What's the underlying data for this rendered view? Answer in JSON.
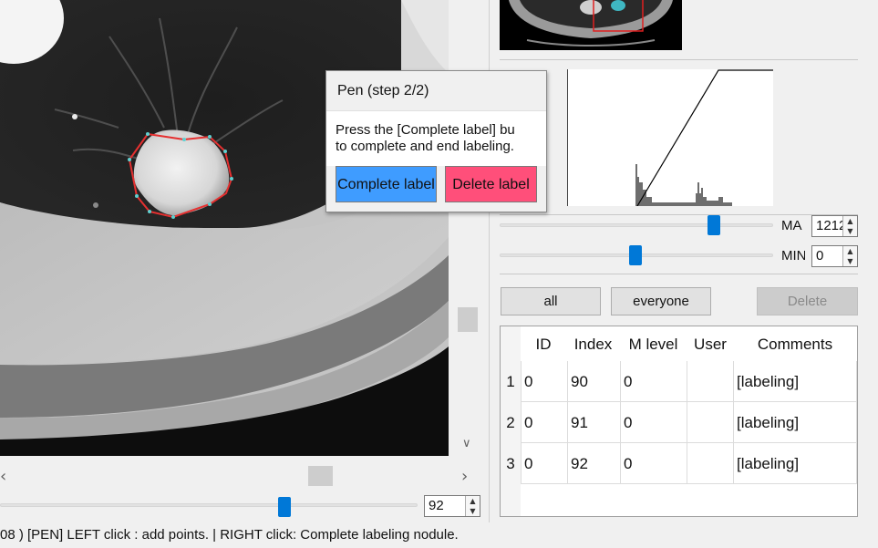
{
  "viewer": {
    "slice_value": "92",
    "status_text": "08 )  [PEN] LEFT click : add points. | RIGHT click: Complete labeling nodule."
  },
  "window": {
    "max_label": "MA",
    "max_value": "1212",
    "min_label": "MIN",
    "min_value": "0"
  },
  "buttons": {
    "all": "all",
    "everyone": "everyone",
    "delete": "Delete"
  },
  "table": {
    "headers": [
      "ID",
      "Index",
      "M level",
      "User",
      "Comments"
    ],
    "rows": [
      {
        "num": "1",
        "id": "0",
        "index": "90",
        "mlevel": "0",
        "user": "",
        "comments": "[labeling]"
      },
      {
        "num": "2",
        "id": "0",
        "index": "91",
        "mlevel": "0",
        "user": "",
        "comments": "[labeling]"
      },
      {
        "num": "3",
        "id": "0",
        "index": "92",
        "mlevel": "0",
        "user": "",
        "comments": "[labeling]"
      }
    ]
  },
  "popup": {
    "title": "Pen (step 2/2)",
    "message_line1": "Press the [Complete label] bu",
    "message_line2": " to complete and end labeling.",
    "complete_label": "Complete label",
    "delete_label": "Delete label",
    "complete_color": "#3f9cff",
    "delete_color": "#ff4f7a"
  },
  "colors": {
    "accent": "#0078d7",
    "contour": "#e53030",
    "thumbnail_roi": "#e02020"
  }
}
